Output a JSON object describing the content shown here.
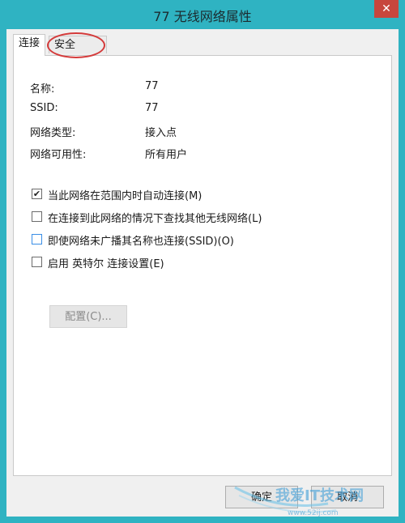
{
  "window": {
    "title": "77 无线网络属性",
    "close_glyph": "✕"
  },
  "tabs": [
    {
      "label": "连接",
      "active": true
    },
    {
      "label": "安全",
      "active": false
    }
  ],
  "info": [
    {
      "label": "名称:",
      "value": "77"
    },
    {
      "label": "SSID:",
      "value": "77"
    },
    {
      "label": "网络类型:",
      "value": "接入点"
    },
    {
      "label": "网络可用性:",
      "value": "所有用户"
    }
  ],
  "options": [
    {
      "label": "当此网络在范围内时自动连接(M)",
      "checked": true
    },
    {
      "label": "在连接到此网络的情况下查找其他无线网络(L)",
      "checked": false
    },
    {
      "label": "即使网络未广播其名称也连接(SSID)(O)",
      "checked": false
    },
    {
      "label": "启用 英特尔 连接设置(E)",
      "checked": false
    }
  ],
  "config_button": "配置(C)...",
  "buttons": {
    "ok": "确定",
    "cancel": "取消"
  },
  "watermark": {
    "text": "我爱IT技术网",
    "url": "www.52ij.com"
  },
  "colors": {
    "titlebar": "#2fb3c2",
    "close": "#c7463d",
    "annotation": "#d43a3a"
  }
}
